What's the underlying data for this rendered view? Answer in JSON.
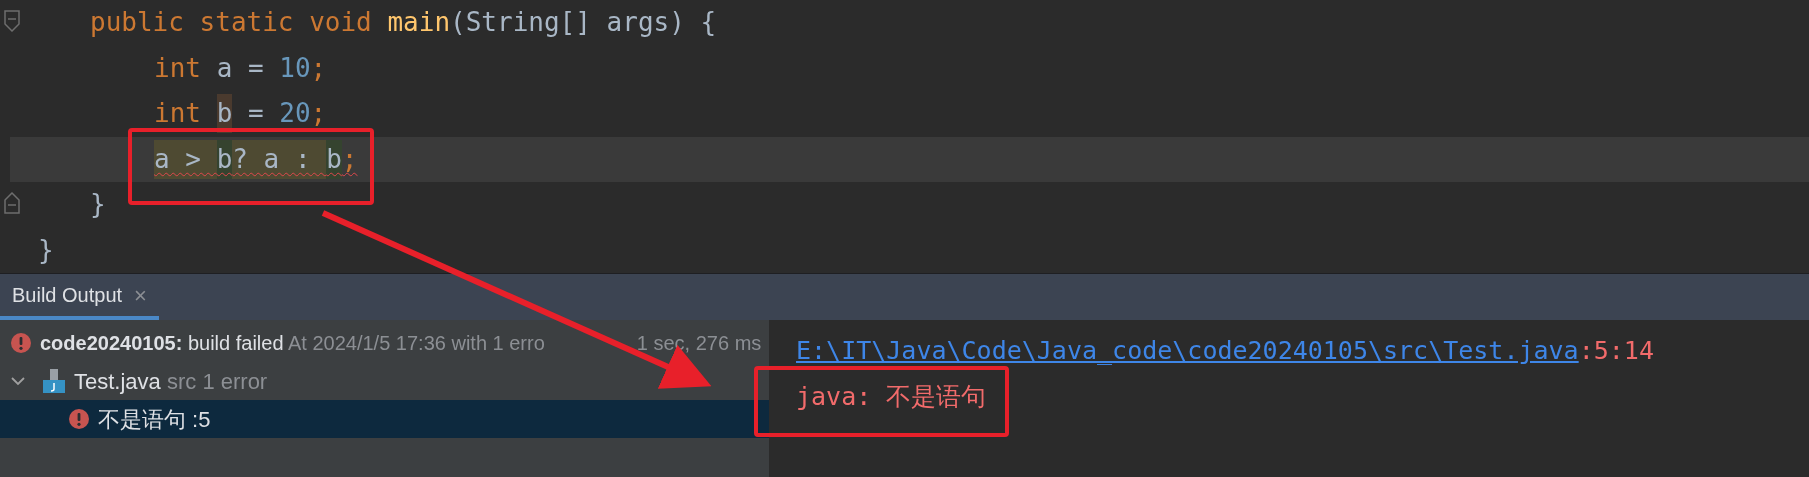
{
  "editor": {
    "class_body": [
      {
        "kind": "fold_start",
        "current": false,
        "tokens": [
          {
            "kind": "keyword",
            "text": "public static void "
          },
          {
            "kind": "method",
            "text": "main"
          },
          {
            "kind": "plain",
            "text": "(String[] args) {"
          }
        ],
        "children": [
          {
            "current": false,
            "tokens": [
              {
                "kind": "keyword",
                "text": "int "
              },
              {
                "kind": "plain",
                "text": "a = "
              },
              {
                "kind": "number",
                "text": "10"
              },
              {
                "kind": "keyword",
                "text": ";"
              }
            ]
          },
          {
            "current": false,
            "tokens": [
              {
                "kind": "keyword",
                "text": "int "
              },
              {
                "kind": "plain",
                "text": "b",
                "color": "#4a3a2e"
              },
              {
                "kind": "plain",
                "text": " = "
              },
              {
                "kind": "number",
                "text": "20"
              },
              {
                "kind": "keyword",
                "text": ";"
              }
            ]
          },
          {
            "current": true,
            "tokens": [
              {
                "kind": "plain",
                "text": "a > ",
                "color": "#4e4a32",
                "error": true
              },
              {
                "kind": "plain",
                "text": "b",
                "color": "#35432f",
                "error": true
              },
              {
                "kind": "plain",
                "text": "? a : ",
                "color": "#4e4a32",
                "error": true
              },
              {
                "kind": "plain",
                "text": "b",
                "color": "#35432f",
                "error": true
              },
              {
                "kind": "keyword",
                "text": ";",
                "error": true
              }
            ]
          }
        ]
      },
      {
        "kind": "fold_end",
        "current": false,
        "tokens": [
          {
            "kind": "plain",
            "text": "}"
          }
        ]
      }
    ],
    "lines": [
      {
        "current": false,
        "tokens": [
          {
            "kind": "plain",
            "text": "}"
          }
        ]
      }
    ]
  },
  "tool_window": {
    "tabs": [
      {
        "label": "Build Output",
        "selected": true,
        "close": "×"
      }
    ]
  },
  "build_tree": {
    "items": [
      {
        "kind": "build",
        "name": "code20240105:",
        "status": "build failed",
        "detail": "At 2024/1/5 17:36 with 1 erro",
        "detail_after": "1 sec, 276 ms",
        "selected": false,
        "children": [
          {
            "kind": "file",
            "name": "Test.java",
            "detail": "src 1 error",
            "expanded": true,
            "selected": false,
            "children": [
              {
                "kind": "message",
                "name": "不是语句 :5",
                "selected": true
              }
            ]
          }
        ]
      }
    ]
  },
  "console": {
    "lines": [
      [
        {
          "kind": "link",
          "text": "E:\\IT\\Java\\Code\\Java_code\\code20240105\\src\\Test.java"
        },
        {
          "kind": "error",
          "text": ":5:14"
        }
      ],
      [
        {
          "kind": "error",
          "text": "java: 不是语句"
        }
      ]
    ]
  }
}
